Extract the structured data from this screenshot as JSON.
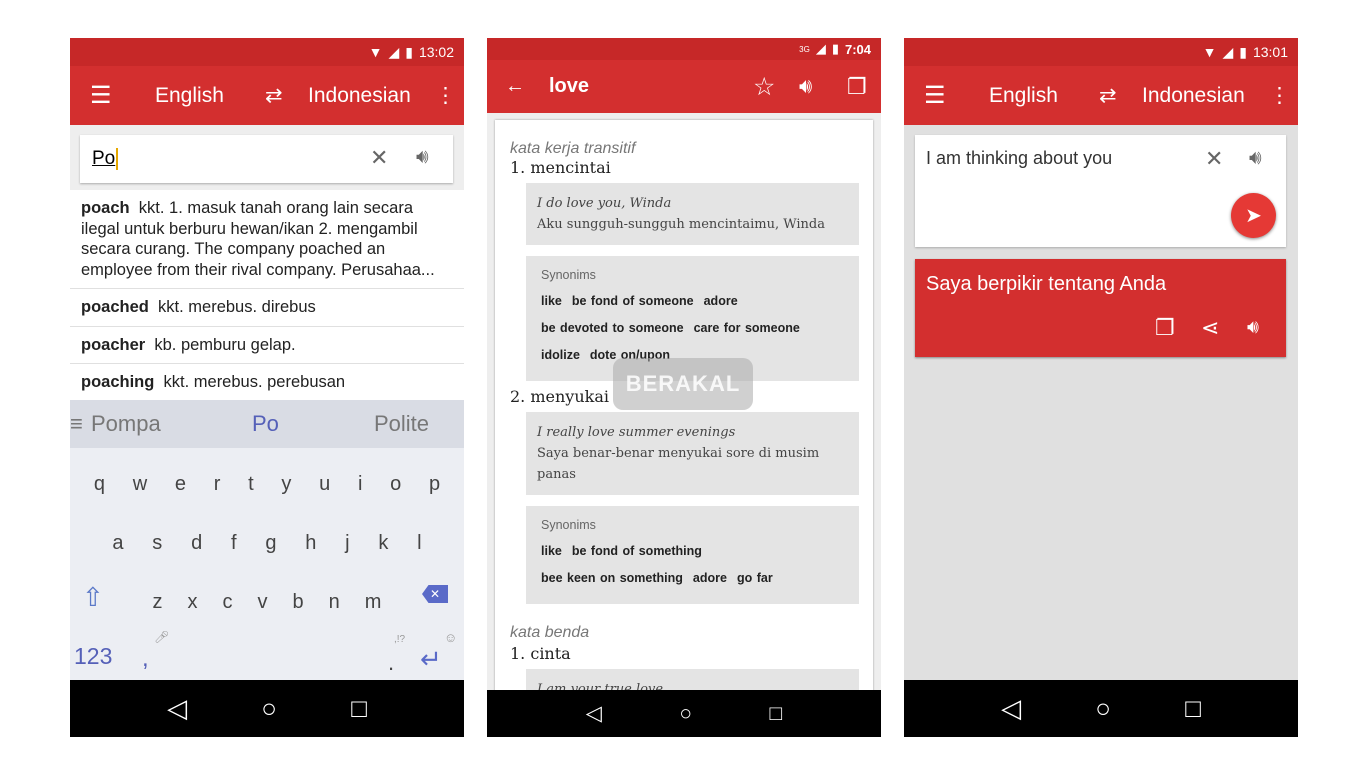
{
  "screens": [
    {
      "status_time": "13:02",
      "toolbar": {
        "source_lang": "English",
        "target_lang": "Indonesian"
      },
      "search": {
        "value": "Po"
      },
      "results": [
        {
          "word": "poach",
          "definition": "kkt. 1. masuk tanah orang lain secara ilegal untuk berburu hewan/ikan 2. mengambil secara curang. The company poached an employee from their rival company. Perusahaa..."
        },
        {
          "word": "poached",
          "definition": "kkt. merebus. direbus"
        },
        {
          "word": "poacher",
          "definition": "kb. pemburu gelap."
        },
        {
          "word": "poaching",
          "definition": "kkt. merebus. perebusan"
        }
      ],
      "keyboard": {
        "suggestions": [
          "Pompa",
          "Po",
          "Polite"
        ],
        "row1": [
          "q",
          "w",
          "e",
          "r",
          "t",
          "y",
          "u",
          "i",
          "o",
          "p"
        ],
        "row2": [
          "a",
          "s",
          "d",
          "f",
          "g",
          "h",
          "j",
          "k",
          "l"
        ],
        "row3": [
          "z",
          "x",
          "c",
          "v",
          "b",
          "n",
          "m"
        ],
        "numbers_key": "123",
        "comma_key": ",",
        "period_key": ".",
        "punct_hint": ",!?"
      }
    },
    {
      "status_time": "7:04",
      "status_network": "3G",
      "toolbar": {
        "title": "love"
      },
      "sections": [
        {
          "pos": "kata kerja transitif",
          "senses": [
            {
              "label": "1. mencintai",
              "example_en": "I do love you, Winda",
              "example_id": "Aku sungguh-sungguh mencintaimu, Winda",
              "synonyms_label": "Synonims",
              "synonyms": [
                [
                  "like",
                  "be fond of someone",
                  "adore"
                ],
                [
                  "be devoted to someone",
                  "care for someone"
                ],
                [
                  "idolize",
                  "dote on/upon"
                ]
              ]
            },
            {
              "label": "2. menyukai",
              "example_en": "I really love summer evenings",
              "example_id": "Saya benar-benar menyukai sore di musim panas",
              "synonyms_label": "Synonims",
              "synonyms": [
                [
                  "like",
                  "be fond of something"
                ],
                [
                  "bee keen on something",
                  "adore",
                  "go far"
                ]
              ]
            }
          ]
        },
        {
          "pos": "kata benda",
          "senses": [
            {
              "label": "1. cinta",
              "example_en": "I am your true love"
            }
          ]
        }
      ],
      "watermark": "BERAKAL"
    },
    {
      "status_time": "13:01",
      "toolbar": {
        "source_lang": "English",
        "target_lang": "Indonesian"
      },
      "input": {
        "value": "I am thinking about you"
      },
      "translation": "Saya berpikir tentang Anda"
    }
  ],
  "colors": {
    "primary": "#d32f2f",
    "status": "#c62828",
    "accent": "#e53935"
  }
}
